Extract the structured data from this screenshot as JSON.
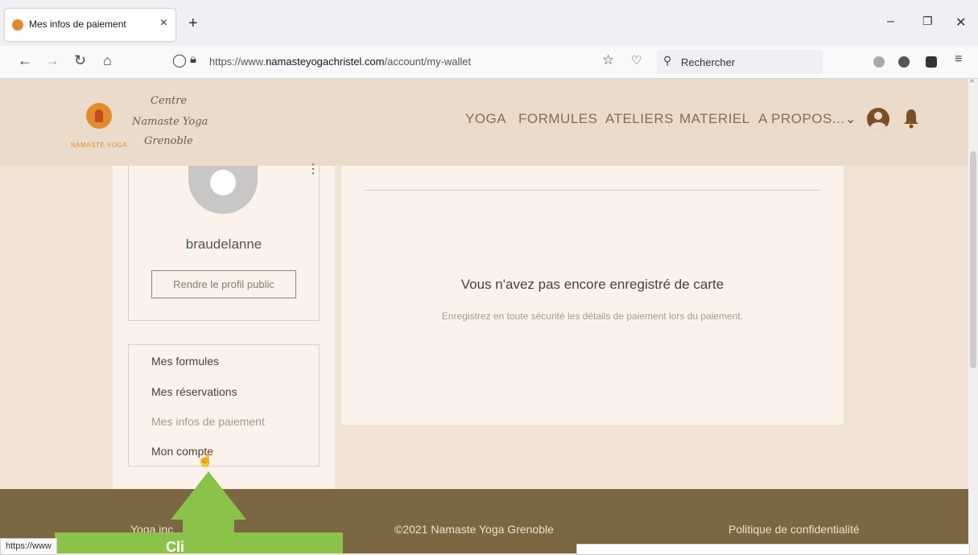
{
  "browser": {
    "tab_title": "Mes infos de paiement",
    "url_prefix": "https://www.",
    "url_domain": "namasteyogachristel.com",
    "url_path": "/account/my-wallet",
    "search_placeholder": "Rechercher",
    "status_url": "https://www"
  },
  "header": {
    "brand_line1": "Centre",
    "brand_line2": "Namaste Yoga",
    "brand_line3": "Grenoble",
    "logo_text": "NAMASTE YOGA",
    "menu": [
      "YOGA",
      "FORMULES",
      "ATELIERS",
      "MATERIEL",
      "A PROPOS..."
    ]
  },
  "profile": {
    "username": "braudelanne",
    "public_button": "Rendre le profil public"
  },
  "sidebar": {
    "links": [
      "Mes formules",
      "Mes réservations",
      "Mes infos de paiement",
      "Mon compte"
    ]
  },
  "main": {
    "empty_title": "Vous n'avez pas encore enregistré de carte",
    "empty_subtitle": "Enregistrez en toute sécurité les détails de paiement lors du paiement."
  },
  "footer": {
    "left": "Yoga inc",
    "center": "©2021 Namaste Yoga Grenoble",
    "right": "Politique de confidentialité"
  },
  "overlay": {
    "callout_text": "Cli",
    "accent_color": "#8bc34a"
  }
}
